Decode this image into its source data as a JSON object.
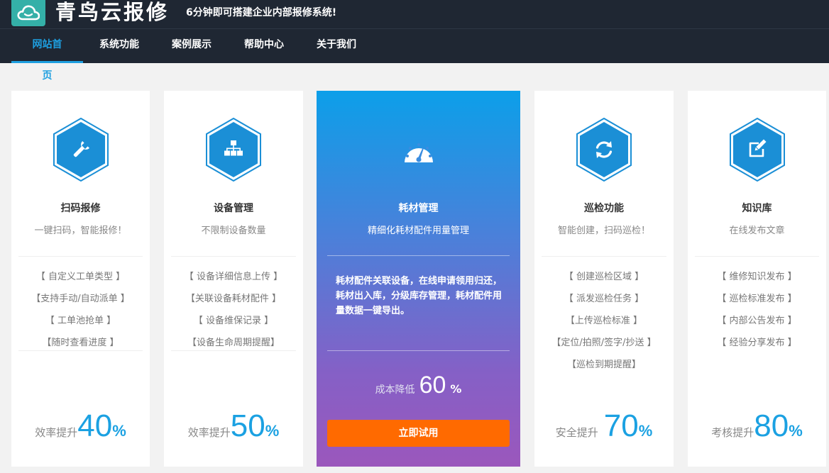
{
  "brand": {
    "name": "青鸟云报修",
    "slogan": "6分钟即可搭建企业内部报修系统!"
  },
  "nav": [
    {
      "label": "网站首页",
      "active": true
    },
    {
      "label": "系统功能"
    },
    {
      "label": "案例展示"
    },
    {
      "label": "帮助中心"
    },
    {
      "label": "关于我们"
    }
  ],
  "colors": {
    "accent": "#1e9fe0",
    "header": "#1f2733",
    "button": "#ff6a00"
  },
  "cards": [
    {
      "icon": "wrench-icon",
      "title": "扫码报修",
      "subtitle": "一键扫码，智能报修！",
      "features": [
        "【 自定义工单类型 】",
        "【支持手动/自动派单 】",
        "【 工单池抢单 】",
        "【随时查看进度 】"
      ],
      "stat": {
        "label": "效率提升",
        "value": "40",
        "unit": "%"
      }
    },
    {
      "icon": "sitemap-icon",
      "title": "设备管理",
      "subtitle": "不限制设备数量",
      "features": [
        "【 设备详细信息上传 】",
        "【关联设备耗材配件 】",
        "【 设备维保记录 】",
        "【设备生命周期提醒】"
      ],
      "stat": {
        "label": "效率提升",
        "value": "50",
        "unit": "%"
      }
    },
    {
      "icon": "dashboard-icon",
      "title": "耗材管理",
      "subtitle": "精细化耗材配件用量管理",
      "description": "耗材配件关联设备，在线申请领用归还，耗材出入库，分级库存管理，耗材配件用量数据一键导出。",
      "stat": {
        "label": "成本降低",
        "value": "60",
        "unit": "%"
      },
      "button": "立即试用"
    },
    {
      "icon": "refresh-icon",
      "title": "巡检功能",
      "subtitle": "智能创建，扫码巡检！",
      "features": [
        "【 创建巡检区域 】",
        "【 派发巡检任务 】",
        "【上传巡检标准 】",
        "【定位/拍照/签字/抄送 】",
        "【巡检到期提醒】"
      ],
      "stat": {
        "label": "安全提升",
        "value": "70",
        "unit": "%"
      }
    },
    {
      "icon": "edit-icon",
      "title": "知识库",
      "subtitle": "在线发布文章",
      "features": [
        "【 维修知识发布 】",
        "【 巡检标准发布 】",
        "【 内部公告发布 】",
        "【 经验分享发布 】"
      ],
      "stat": {
        "label": "考核提升",
        "value": "80",
        "unit": "%"
      }
    }
  ]
}
